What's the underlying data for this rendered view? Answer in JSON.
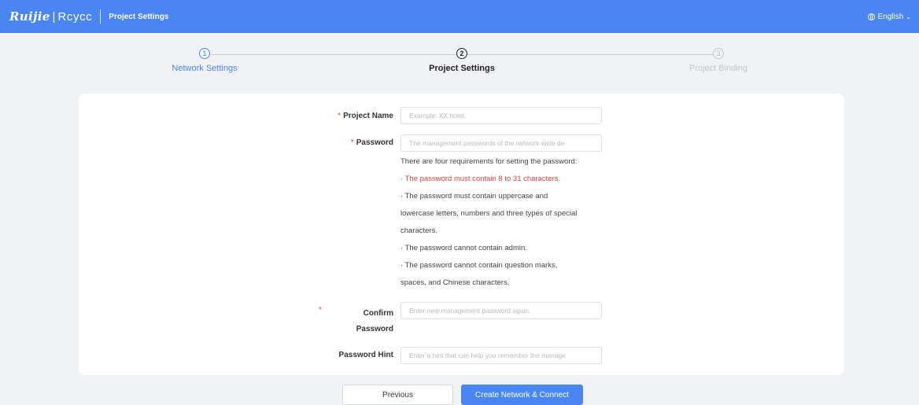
{
  "header": {
    "brand_ruijie": "Ruijie",
    "brand_sep": "|",
    "brand_reyee": "Rcycc",
    "title": "Project Settings",
    "language": "English"
  },
  "steps": [
    {
      "number": "1",
      "label": "Network Settings",
      "state": "done"
    },
    {
      "number": "2",
      "label": "Project Settings",
      "state": "active"
    },
    {
      "number": "3",
      "label": "Project Binding",
      "state": "pending"
    }
  ],
  "form": {
    "required_mark": "*",
    "project_name": {
      "label": "Project Name",
      "placeholder": "Example: XX hotel.",
      "value": ""
    },
    "password": {
      "label": "Password",
      "placeholder": "The management passwords of the network-wide de",
      "value": ""
    },
    "password_rules": {
      "intro": "There are four requirements for setting the password:",
      "lines": [
        "· The password must contain 8 to 31 characters.",
        "· The password must contain uppercase and",
        "lowercase letters, numbers and three types of special",
        "characters.",
        "· The password cannot contain admin.",
        "· The password cannot contain question marks,",
        "spaces, and Chinese characters."
      ]
    },
    "confirm_password": {
      "label_line1": "Confirm",
      "label_line2": "Password",
      "placeholder": "Enter new management password again.",
      "value": ""
    },
    "password_hint": {
      "label": "Password Hint",
      "placeholder": "Enter a hint that can help you remember the manage",
      "value": ""
    }
  },
  "buttons": {
    "previous": "Previous",
    "create": "Create Network & Connect"
  },
  "colors": {
    "brand_blue": "#4a86f2",
    "required_red": "#e64a3c",
    "rule_red": "#d9453b",
    "page_bg": "#f1f2f5"
  }
}
